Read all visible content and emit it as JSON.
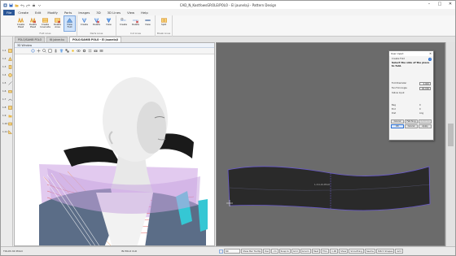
{
  "titlebar": {
    "title": "CAD_N_KostfowsGROLE/POLO - El jaunelaji - Pattern Design",
    "minimize": "–",
    "maximize": "□",
    "close": "✕"
  },
  "ribbon": {
    "tabs": [
      "File",
      "Create",
      "Edit",
      "Modify",
      "Parts",
      "Images",
      "3D",
      "3D Lines",
      "View",
      "Help"
    ],
    "groups": [
      {
        "label": "Fold Lines",
        "buttons": [
          "Create Pleat",
          "Delete Pleat",
          "Create Innerside",
          "Delete Area",
          "View Fold"
        ]
      },
      {
        "label": "Darts Lines",
        "buttons": [
          "Create",
          "Delete",
          "View"
        ]
      },
      {
        "label": "Cut Lines",
        "buttons": [
          "Create",
          "Delete",
          "View"
        ]
      },
      {
        "label": "Break Lines",
        "buttons": [
          "Split"
        ]
      }
    ]
  },
  "doc_tabs": [
    "POLO/SAHIB POLO",
    "Kt joiner.ku",
    "POLO/SAHIB POLO - El jaunelaji"
  ],
  "left_tools": [
    "1.1",
    "1.2",
    "1.3",
    "1.4",
    "1.5",
    "1.6",
    "1.7",
    "1.8",
    "1.9",
    "1.10",
    "1.11"
  ],
  "win3d": {
    "title": "3D Window"
  },
  "pattern": {
    "label": "1-3-6-10-POLO"
  },
  "dialog": {
    "title": "User input",
    "subtitle": "Create Fold",
    "instruction": "Select the side of the piece to fold.",
    "fields": [
      {
        "label": "Fold Diameter",
        "value": "0.000"
      },
      {
        "label": "Fan Fold Angle",
        "value": "90.000"
      },
      {
        "label": "Yellow Input",
        "value": ""
      }
    ],
    "rows": [
      {
        "label": "Beg",
        "value": "0"
      },
      {
        "label": "End",
        "value": "0"
      },
      {
        "label": "Dist",
        "value": "Ang"
      }
    ],
    "buttons_row1": [
      "Cancel",
      "Fetching",
      "Optimize"
    ],
    "buttons_row2": [
      "OK",
      "Cancel",
      "Apply"
    ]
  },
  "statusbar": {
    "left": "TOLOS 60 POLO",
    "middle": "IN POLO CLR",
    "zoom": "60",
    "buttons": [
      "Show Bar Tooltip",
      "Dec",
      "cm",
      "Snap to",
      "Grid",
      "Groom",
      "Heat",
      "Thru",
      "1.00",
      "Show",
      "Smoothing",
      "Seams",
      "Stitch Shapes",
      "Grid"
    ]
  },
  "colors": {
    "accent": "#2b5797",
    "viewport_bg": "#6b6b6b",
    "pattern_fill": "#2a2a2a",
    "pattern_outline": "#6a5acd",
    "collar_purple": "#c9a6e0",
    "shirt_cyan": "#35c7d4",
    "shirt_slate": "#5b6d87"
  }
}
